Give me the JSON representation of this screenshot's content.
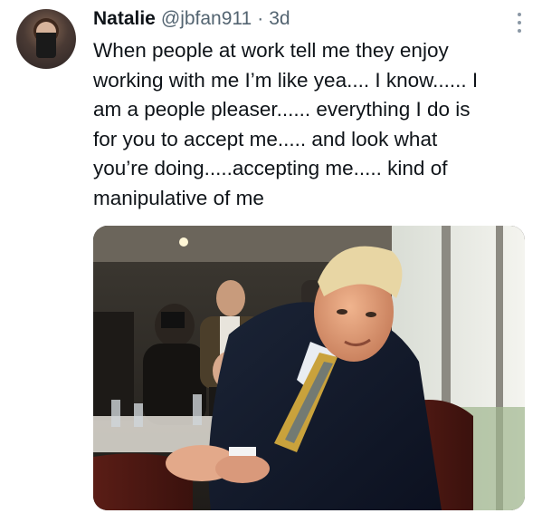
{
  "tweet": {
    "author_name": "Natalie",
    "author_handle": "@jbfan911",
    "separator": "·",
    "time": "3d",
    "text_lines": [
      "When people at work tell me they enjoy",
      "working with me I’m like yea.... I know...... I",
      "am a people pleaser...... everything I do is",
      "for you to accept me..... and look what",
      "you’re doing.....accepting me..... kind of",
      "manipulative of me"
    ]
  },
  "icons": {
    "more": "more-vertical-icon"
  },
  "colors": {
    "text": "#0f1419",
    "secondary": "#536471",
    "background": "#ffffff"
  }
}
